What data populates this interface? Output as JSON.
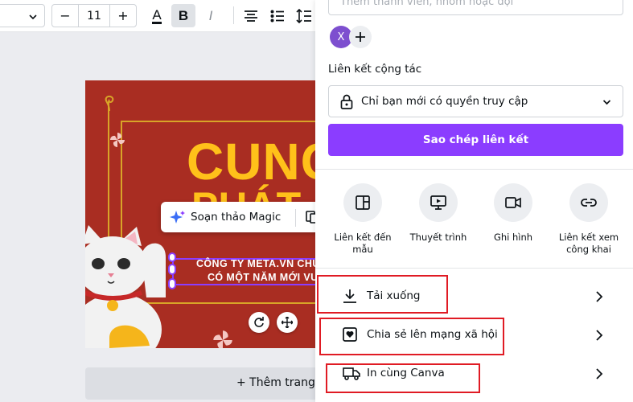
{
  "toolbar": {
    "font_size": "11",
    "decrease_label": "−",
    "increase_label": "+",
    "text_color_letter": "A",
    "bold_letter": "B",
    "italic_letter": "I"
  },
  "canvas": {
    "title_line1": "CUNG",
    "title_line2": "PHÁT",
    "selected_line1": "CÔNG TY META.VN CHÚ",
    "selected_line2": "CÓ MỘT NĂM MỚI VU",
    "magic_label": "Soạn thảo Magic",
    "add_page_label": "+ Thêm trang",
    "colors": {
      "background": "#a92d22",
      "gold": "#ffc11a",
      "selection": "#8b3dff"
    }
  },
  "share": {
    "invite_placeholder": "Thêm thành viên, nhóm hoặc đội",
    "avatar_initial": "X",
    "collab_link_label": "Liên kết cộng tác",
    "access_option": "Chỉ bạn mới có quyền truy cập",
    "copy_link_button": "Sao chép liên kết",
    "options": [
      {
        "label": "Liên kết đến mẫu",
        "icon": "template-icon"
      },
      {
        "label": "Thuyết trình",
        "icon": "present-icon"
      },
      {
        "label": "Ghi hình",
        "icon": "video-camera-icon"
      },
      {
        "label": "Liên kết xem công khai",
        "icon": "link-icon"
      }
    ],
    "rows": [
      {
        "label": "Tải xuống",
        "icon": "download-icon"
      },
      {
        "label": "Chia sẻ lên mạng xã hội",
        "icon": "heart-icon"
      },
      {
        "label": "In cùng Canva",
        "icon": "truck-icon"
      }
    ],
    "accent_color": "#8b3dff",
    "highlight_color": "#e01b24"
  }
}
